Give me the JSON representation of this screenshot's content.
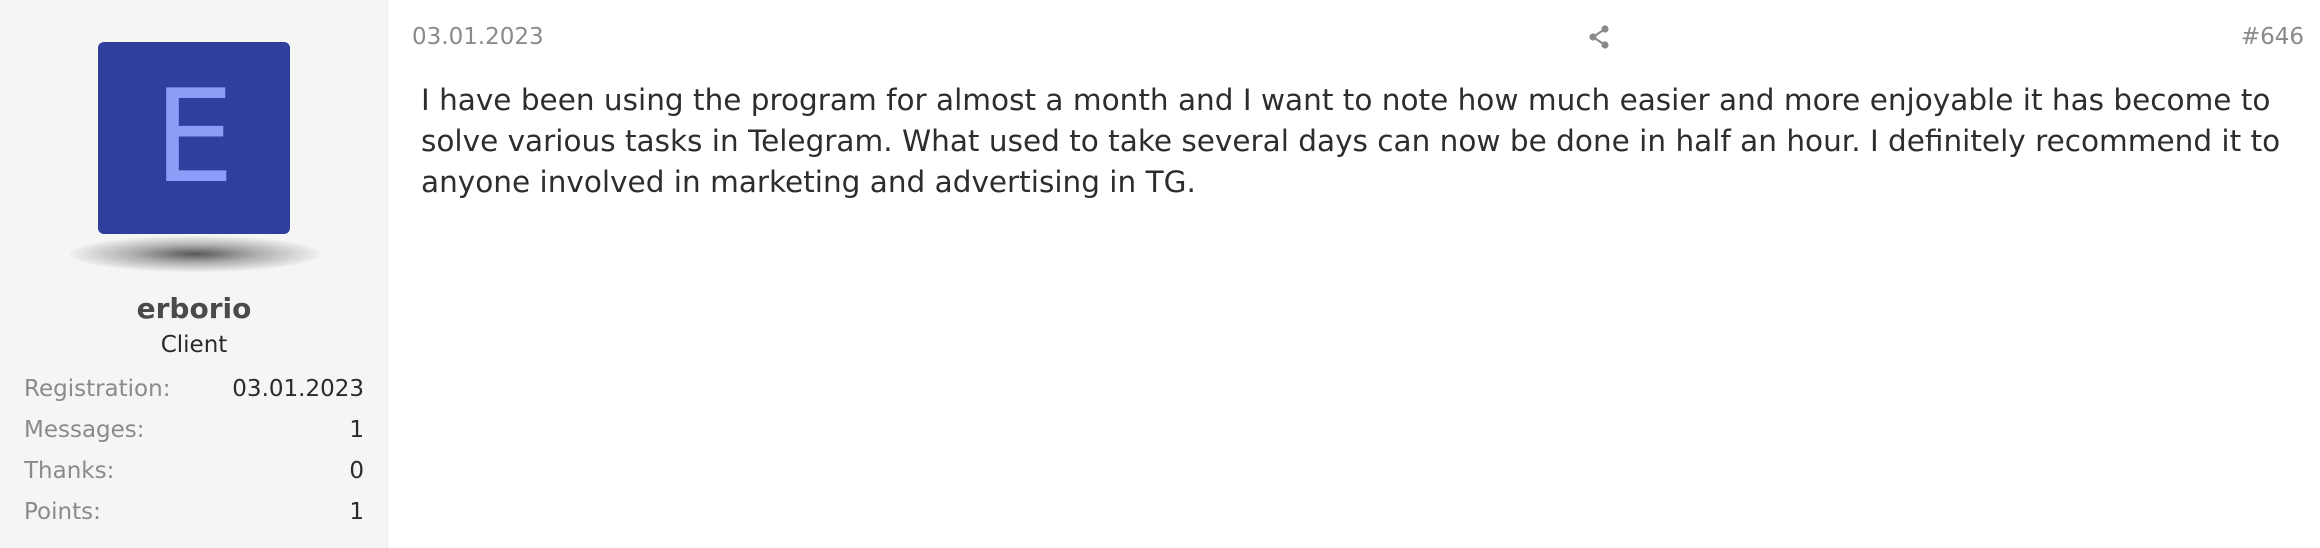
{
  "user": {
    "avatar_letter": "E",
    "avatar_bg": "#303e9c",
    "avatar_fg": "#8c9cf7",
    "username": "erborio",
    "title": "Client",
    "stats": [
      {
        "label": "Registration:",
        "value": "03.01.2023"
      },
      {
        "label": "Messages:",
        "value": "1"
      },
      {
        "label": "Thanks:",
        "value": "0"
      },
      {
        "label": "Points:",
        "value": "1"
      }
    ]
  },
  "post": {
    "date": "03.01.2023",
    "share_icon": "share-icon",
    "number": "#646",
    "body": "I have been using the program for almost a month and I want to note how much easier and more enjoyable it has become to solve various tasks in Telegram. What used to take several days can now be done in half an hour. I definitely recommend it to anyone involved in marketing and advertising in TG."
  }
}
